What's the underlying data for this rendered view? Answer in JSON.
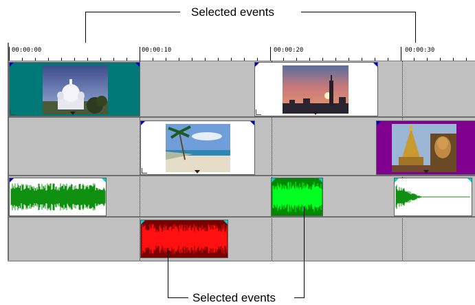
{
  "callouts": {
    "top_label": "Selected events",
    "bottom_label": "Selected events"
  },
  "ruler": {
    "timecodes": [
      "00:00:00",
      "00:00:10",
      "00:00:20",
      "00:00:30"
    ]
  },
  "colors": {
    "selected_video_teal": "#007878",
    "selected_video_purple": "#800090",
    "selected_audio_green": "#00a000",
    "selected_audio_red": "#b00000",
    "audio_wave_green": "#109010",
    "event_marker_blue": "#0000c8"
  },
  "tracks": [
    {
      "type": "video",
      "events": [
        "temple-dome",
        "sunset-skyline"
      ]
    },
    {
      "type": "video",
      "events": [
        "beach-palm",
        "golden-pagoda"
      ]
    },
    {
      "type": "audio",
      "events": [
        "waveform-1",
        "waveform-2",
        "waveform-3"
      ]
    },
    {
      "type": "audio",
      "events": [
        "waveform-4"
      ]
    }
  ]
}
